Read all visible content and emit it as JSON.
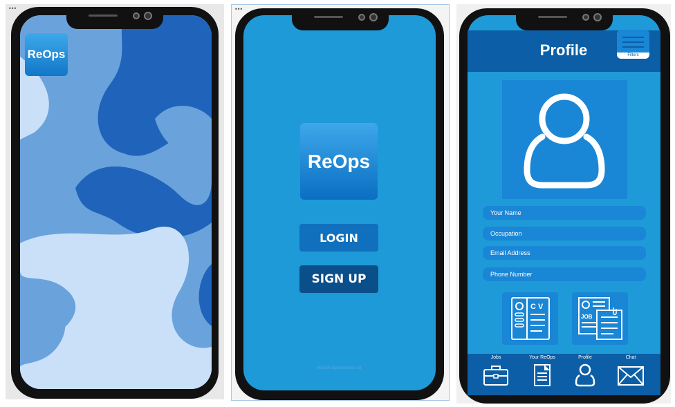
{
  "splash": {
    "logo_text": "ReOps"
  },
  "welcome": {
    "logo_text": "ReOps",
    "login_label": "LOGIN",
    "signup_label": "SIGN UP",
    "footer_text": "Recruit Opportunities ltd"
  },
  "profile": {
    "title": "Profile",
    "filters_label": "Filters",
    "fields": [
      {
        "placeholder": "Your Name"
      },
      {
        "placeholder": "Occupation"
      },
      {
        "placeholder": "Email Address"
      },
      {
        "placeholder": "Phone Number"
      }
    ],
    "cards": [
      {
        "icon": "cv-document-icon",
        "text": "C V"
      },
      {
        "icon": "job-files-icon",
        "text": "JOB"
      }
    ],
    "nav": [
      {
        "label": "Jobs",
        "icon": "briefcase-icon"
      },
      {
        "label": "Your ReOps",
        "icon": "document-icon"
      },
      {
        "label": "Profile",
        "icon": "user-icon"
      },
      {
        "label": "Chat",
        "icon": "mail-icon"
      }
    ]
  },
  "colors": {
    "primary": "#1e9ad8",
    "dark": "#0c5fa6",
    "button_dark": "#0b4f8a",
    "wave_light": "#c9e0f8",
    "wave_mid": "#6aa2dc",
    "wave_dark": "#1f64ba"
  }
}
